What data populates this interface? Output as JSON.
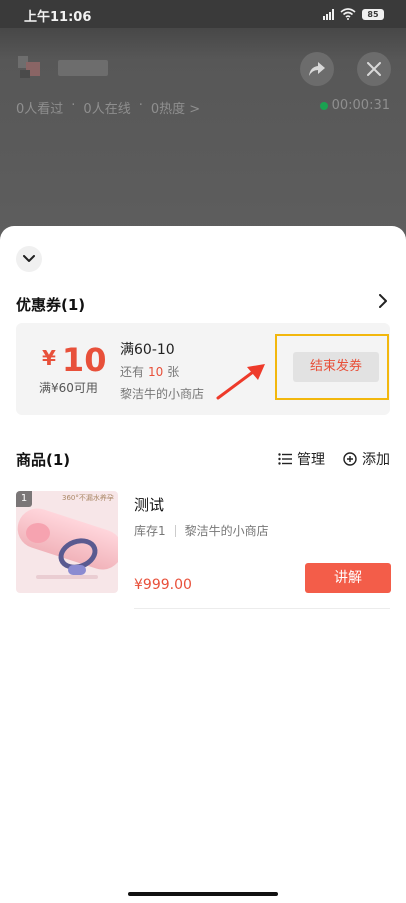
{
  "status_bar": {
    "time": "上午11:06",
    "battery": "85"
  },
  "live_room": {
    "stats": [
      "0人看过",
      "0人在线",
      "0热度 >"
    ],
    "separator": "·",
    "timer": "00:00:31"
  },
  "coupon_section": {
    "title": "优惠券(1)",
    "coupon": {
      "currency": "¥",
      "amount": "10",
      "condition": "满¥60可用",
      "title": "满60-10",
      "remaining_prefix": "还有",
      "remaining_count": "10",
      "remaining_suffix": "张",
      "shop": "黎洁牛的小商店",
      "end_button": "结束发券"
    }
  },
  "goods_section": {
    "title": "商品(1)",
    "manage_label": "管理",
    "add_label": "添加",
    "items": [
      {
        "index": "1",
        "image_caption": "360°不漏水养孕",
        "name": "测试",
        "stock": "库存1",
        "shop": "黎洁牛的小商店",
        "price": "¥999.00",
        "action": "讲解"
      }
    ]
  },
  "colors": {
    "accent": "#e8503a",
    "highlight": "#f2b70d",
    "button": "#f35d49"
  },
  "icons": [
    "wifi-icon",
    "signal-icon",
    "share-icon",
    "close-icon",
    "chevron-down-icon",
    "chevron-right-icon",
    "list-icon",
    "add-circle-icon",
    "arrow-annotation-icon"
  ]
}
